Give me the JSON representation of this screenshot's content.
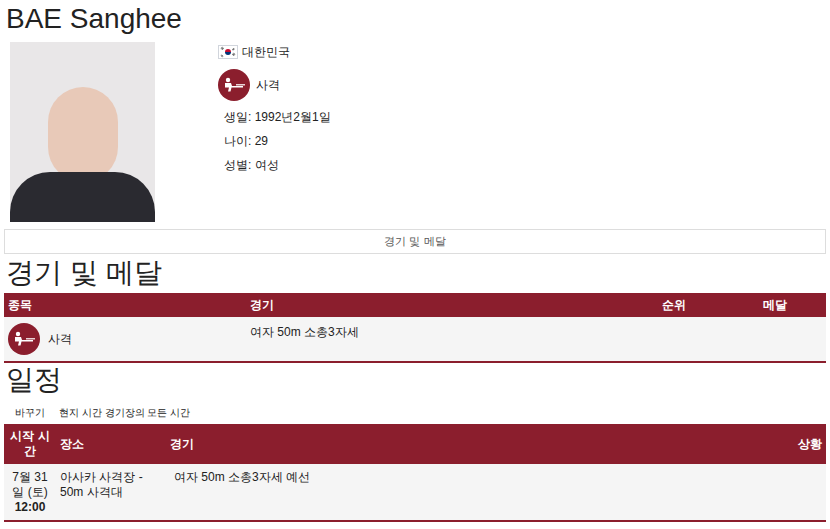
{
  "athlete": {
    "name": "BAE Sanghee",
    "country": "대한민국",
    "sport": "사격",
    "info": [
      "생일: 1992년2월1일",
      "나이: 29",
      "성별: 여성"
    ]
  },
  "tab_button": "경기 및 메달",
  "medals": {
    "heading": "경기 및 메달",
    "columns": [
      "종목",
      "경기",
      "순위",
      "메달"
    ],
    "rows": [
      {
        "sport": "사격",
        "event": "여자 50m 소총3자세",
        "rank": "",
        "medal": ""
      }
    ]
  },
  "schedule": {
    "heading": "일정",
    "toggle": "바꾸기",
    "time_note": "현지 시간 경기장의 모든 시간",
    "columns": [
      "시작 시간",
      "장소",
      "경기",
      "상황"
    ],
    "rows": [
      {
        "date": "7월 31 일 (토)",
        "time": "12:00",
        "venue": "아사카 사격장 - 50m 사격대",
        "event": "여자 50m 소총3자세 예선",
        "status": ""
      }
    ]
  }
}
